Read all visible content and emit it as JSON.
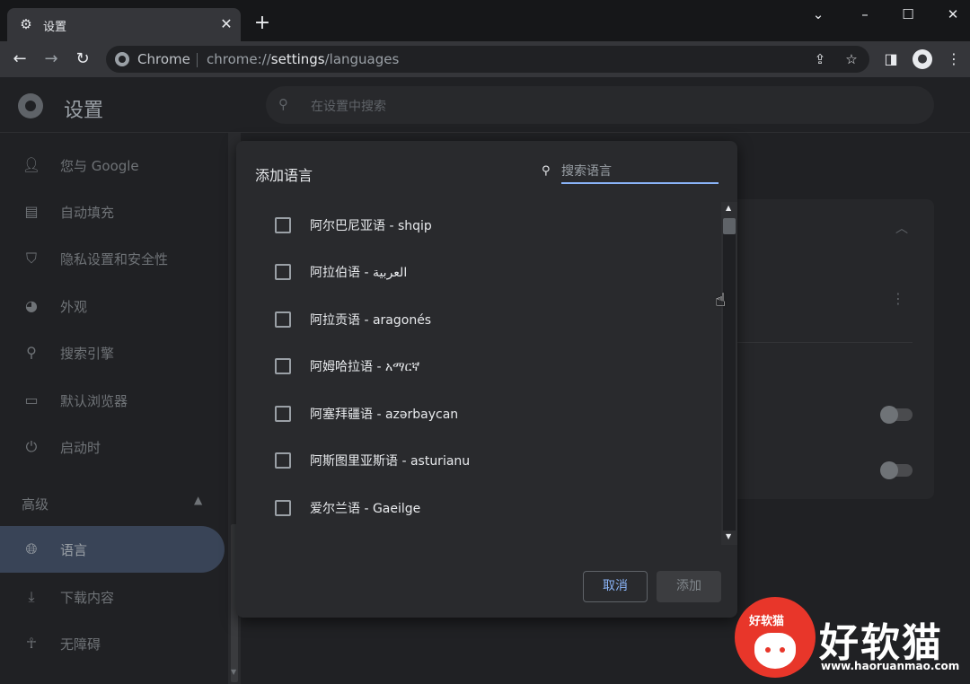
{
  "browser": {
    "tab": {
      "favicon": "gear-icon",
      "title": "设置",
      "close_icon": "close-icon"
    },
    "new_tab_icon": "plus-icon",
    "window_controls": [
      "chevron-down-icon",
      "minimize-icon",
      "maximize-icon",
      "close-icon"
    ],
    "toolbar": {
      "back_icon": "arrow-left-icon",
      "forward_icon": "arrow-right-icon",
      "reload_icon": "reload-icon",
      "site_name": "Chrome",
      "url_scheme": "chrome://",
      "url_host": "settings",
      "url_path": "/languages",
      "share_icon": "share-icon",
      "bookmark_icon": "star-icon",
      "sidepanel_icon": "side-panel-icon",
      "profile_icon": "avatar-icon",
      "menu_icon": "kebab-menu-icon"
    }
  },
  "settings": {
    "title": "设置",
    "search_placeholder": "在设置中搜索",
    "sidebar": {
      "items": [
        {
          "label": "您与 Google",
          "icon": "person-icon"
        },
        {
          "label": "自动填充",
          "icon": "clipboard-icon"
        },
        {
          "label": "隐私设置和安全性",
          "icon": "shield-icon"
        },
        {
          "label": "外观",
          "icon": "palette-icon"
        },
        {
          "label": "搜索引擎",
          "icon": "search-icon"
        },
        {
          "label": "默认浏览器",
          "icon": "browser-icon"
        },
        {
          "label": "启动时",
          "icon": "power-icon"
        }
      ],
      "advanced_label": "高级",
      "advanced_items": [
        {
          "label": "语言",
          "icon": "globe-icon",
          "active": true
        },
        {
          "label": "下载内容",
          "icon": "download-icon"
        },
        {
          "label": "无障碍",
          "icon": "accessibility-icon"
        }
      ]
    }
  },
  "dialog": {
    "title": "添加语言",
    "search_placeholder": "搜索语言",
    "languages": [
      "阿尔巴尼亚语 - shqip",
      "阿拉伯语 - العربية",
      "阿拉贡语 - aragonés",
      "阿姆哈拉语 - አማርኛ",
      "阿塞拜疆语 - azərbaycan",
      "阿斯图里亚斯语 - asturianu",
      "爱尔兰语 - Gaeilge"
    ],
    "cancel_label": "取消",
    "add_label": "添加"
  },
  "watermark": {
    "badge_text": "好软猫",
    "name": "好软猫",
    "url": "www.haoruanmao.com"
  },
  "colors": {
    "accent": "#8ab4f8",
    "active_nav": "#394457",
    "watermark_red": "#e8362a"
  }
}
